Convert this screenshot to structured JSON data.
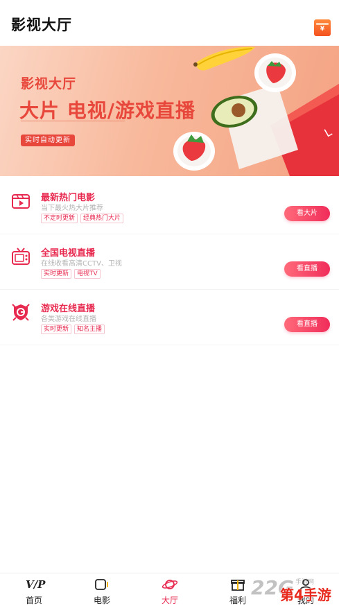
{
  "header": {
    "title": "影视大厅",
    "red_packet_icon": "red-packet-icon",
    "red_packet_symbol": "¥"
  },
  "banner": {
    "line1": "影视大厅",
    "line2": "大片 电视/游戏直播",
    "pill": "实时自动更新",
    "art_text": "L"
  },
  "items": [
    {
      "name": "最新热门电影",
      "desc": "当下最火热大片推荐",
      "tags": [
        "不定时更新",
        "经典热门大片"
      ],
      "button": "看大片",
      "icon": "film-icon"
    },
    {
      "name": "全国电视直播",
      "desc": "在线收看高清CCTV、卫视",
      "tags": [
        "实时更新",
        "电视TV"
      ],
      "button": "看直播",
      "icon": "tv-icon"
    },
    {
      "name": "游戏在线直播",
      "desc": "各类游戏在线直播",
      "tags": [
        "实时更新",
        "知名主播"
      ],
      "button": "看直播",
      "icon": "game-shield-icon"
    }
  ],
  "tabbar": [
    {
      "label": "首页",
      "icon": "vip-icon",
      "glyph": "V/P"
    },
    {
      "label": "电影",
      "icon": "movie-icon"
    },
    {
      "label": "大厅",
      "icon": "planet-icon",
      "active": true
    },
    {
      "label": "福利",
      "icon": "gift-icon"
    },
    {
      "label": "我的",
      "icon": "profile-icon"
    }
  ],
  "watermark": {
    "number": "22G",
    "small": "手游网",
    "brand": "第4手游"
  },
  "colors": {
    "accent": "#e8294f",
    "banner_text": "#e8473c",
    "banner_bg_start": "#fbd6c4",
    "banner_bg_end": "#f4a383"
  }
}
